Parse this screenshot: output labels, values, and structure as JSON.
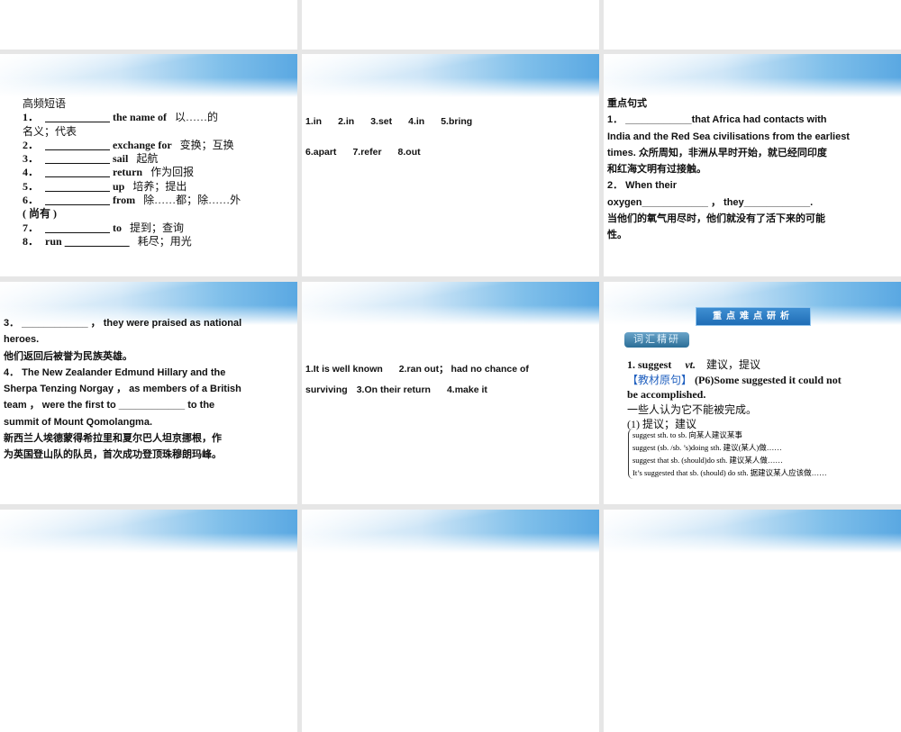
{
  "slide_phrases": {
    "heading": "高频短语",
    "lines": [
      [
        "1．",
        true,
        "the name of",
        "以……的"
      ],
      [
        "名义；代表"
      ],
      [
        "2．",
        true,
        "exchange for",
        "变换；互换"
      ],
      [
        "3．",
        true,
        "sail",
        "起航"
      ],
      [
        "4．",
        true,
        "return",
        "作为回报"
      ],
      [
        "5．",
        true,
        "up",
        "培养；提出"
      ],
      [
        "6．",
        true,
        "from",
        "除……都；除……外"
      ],
      [
        "( 尚有 )"
      ],
      [
        "7．",
        true,
        "to",
        "提到；查询"
      ],
      [
        "8．",
        "run",
        "",
        "耗尽；用光"
      ]
    ],
    "blank": "____________"
  },
  "slide_answers1": {
    "row1": [
      "1.in",
      "2.in",
      "3.set",
      "4.in",
      "5.bring"
    ],
    "row2": [
      "6.apart",
      "7.refer",
      "8.out"
    ]
  },
  "slide_sentences1": {
    "heading": "重点句式",
    "lines": [
      "1．  ____________that Africa had contacts with",
      "India and the Red Sea civilisations from the earliest",
      "times. 众所周知，非洲从早时开始，就已经同印度",
      "和红海文明有过接触。",
      "2．  When their",
      "oxygen____________ ，  they____________.",
      "当他们的氧气用尽时，他们就没有了活下来的可能",
      "性。"
    ]
  },
  "slide_sentences2": {
    "lines": [
      "3．  ____________ ，  they were praised as national",
      "heroes.",
      "他们返回后被誉为民族英雄。",
      "4．  The New Zealander Edmund Hillary and the",
      "Sherpa Tenzing Norgay ，  as members of a British",
      "team ，  were the first to ____________ to the",
      "summit of Mount Qomolangma.",
      "新西兰人埃德蒙得希拉里和夏尔巴人坦京挪根，作",
      "为英国登山队的队员，首次成功登顶珠穆朗玛峰。"
    ]
  },
  "slide_answers2": {
    "row1": [
      "1.It is well known",
      "2.ran out；  had no chance of"
    ],
    "row2": [
      "surviving",
      "3.On their return",
      "4.make it"
    ]
  },
  "slide_analysis": {
    "title": "重点难点研析",
    "subtitle": "词汇精研",
    "word": "1. suggest",
    "pos": "vt.",
    "meaning": "建议，提议",
    "source_label": "【教材原句】",
    "source_ref": "(P6)",
    "source_text": "Some suggested it could not",
    "source_text2": "be accomplished.",
    "translation": "一些人认为它不能被完成。",
    "sense": "(1) 提议；建议",
    "patterns": [
      "suggest sth. to sb. 向某人建议某事",
      "suggest (sb. /sb. ’s)doing sth. 建议(某人)做……",
      "suggest that sb. (should)do sth. 建议某人做……",
      "It’s suggested that sb. (should) do sth. 据建议某人应该做……"
    ]
  }
}
